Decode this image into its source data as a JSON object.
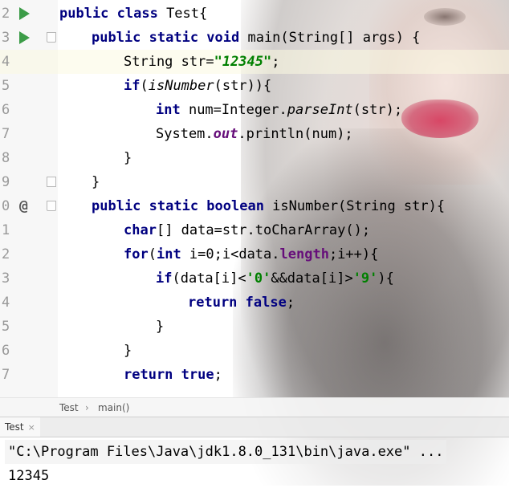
{
  "editor": {
    "lines": [
      {
        "num": "2",
        "gutter_icon": "run",
        "fold": null
      },
      {
        "num": "3",
        "gutter_icon": "run",
        "fold": "open"
      },
      {
        "num": "4",
        "gutter_icon": null,
        "fold": null
      },
      {
        "num": "5",
        "gutter_icon": null,
        "fold": null
      },
      {
        "num": "6",
        "gutter_icon": null,
        "fold": null
      },
      {
        "num": "7",
        "gutter_icon": null,
        "fold": null
      },
      {
        "num": "8",
        "gutter_icon": null,
        "fold": null
      },
      {
        "num": "9",
        "gutter_icon": null,
        "fold": "close"
      },
      {
        "num": "0",
        "gutter_icon": "override",
        "fold": "open"
      },
      {
        "num": "1",
        "gutter_icon": null,
        "fold": null
      },
      {
        "num": "2",
        "gutter_icon": null,
        "fold": null
      },
      {
        "num": "3",
        "gutter_icon": null,
        "fold": null
      },
      {
        "num": "4",
        "gutter_icon": null,
        "fold": null
      },
      {
        "num": "5",
        "gutter_icon": null,
        "fold": null
      },
      {
        "num": "6",
        "gutter_icon": null,
        "fold": null
      },
      {
        "num": "7",
        "gutter_icon": null,
        "fold": null
      }
    ],
    "override_symbol": "@",
    "code": {
      "l2_kw": "public class ",
      "l2_name": "Test{",
      "l3_kw": "public static void ",
      "l3_rest": "main(String[] args) {",
      "l4_type": "String str=",
      "l4_str": "\"12345\"",
      "l4_end": ";",
      "l5_kw": "if",
      "l5_open": "(",
      "l5_call": "isNumber",
      "l5_rest": "(str)){",
      "l6_kw": "int ",
      "l6_a": "num=Integer.",
      "l6_call": "parseInt",
      "l6_b": "(str);",
      "l7_a": "System.",
      "l7_field": "out",
      "l7_b": ".println(num);",
      "l8": "}",
      "l9": "}",
      "l10_kw": "public static boolean ",
      "l10_rest": "isNumber(String str){",
      "l11_kw": "char",
      "l11_rest": "[] data=str.toCharArray();",
      "l12_kw1": "for",
      "l12_a": "(",
      "l12_kw2": "int ",
      "l12_b": "i=0;i<data.",
      "l12_field": "length",
      "l12_c": ";i++){",
      "l13_kw": "if",
      "l13_a": "(data[i]<",
      "l13_s1": "'0'",
      "l13_b": "&&data[i]>",
      "l13_s2": "'9'",
      "l13_c": "){",
      "l14_kw": "return false",
      "l14_end": ";",
      "l15": "}",
      "l16": "}",
      "l17_kw": "return true",
      "l17_end": ";"
    }
  },
  "breadcrumb": {
    "items": [
      "Test",
      "main()"
    ],
    "separator": "›"
  },
  "console": {
    "tab_label": "Test",
    "tab_close": "×",
    "command_line": "\"C:\\Program Files\\Java\\jdk1.8.0_131\\bin\\java.exe\" ...",
    "output": "12345"
  },
  "colors": {
    "keyword": "#000080",
    "string": "#008000",
    "field": "#660e7a",
    "run_icon": "#3c9c48",
    "line_number": "#999999"
  }
}
